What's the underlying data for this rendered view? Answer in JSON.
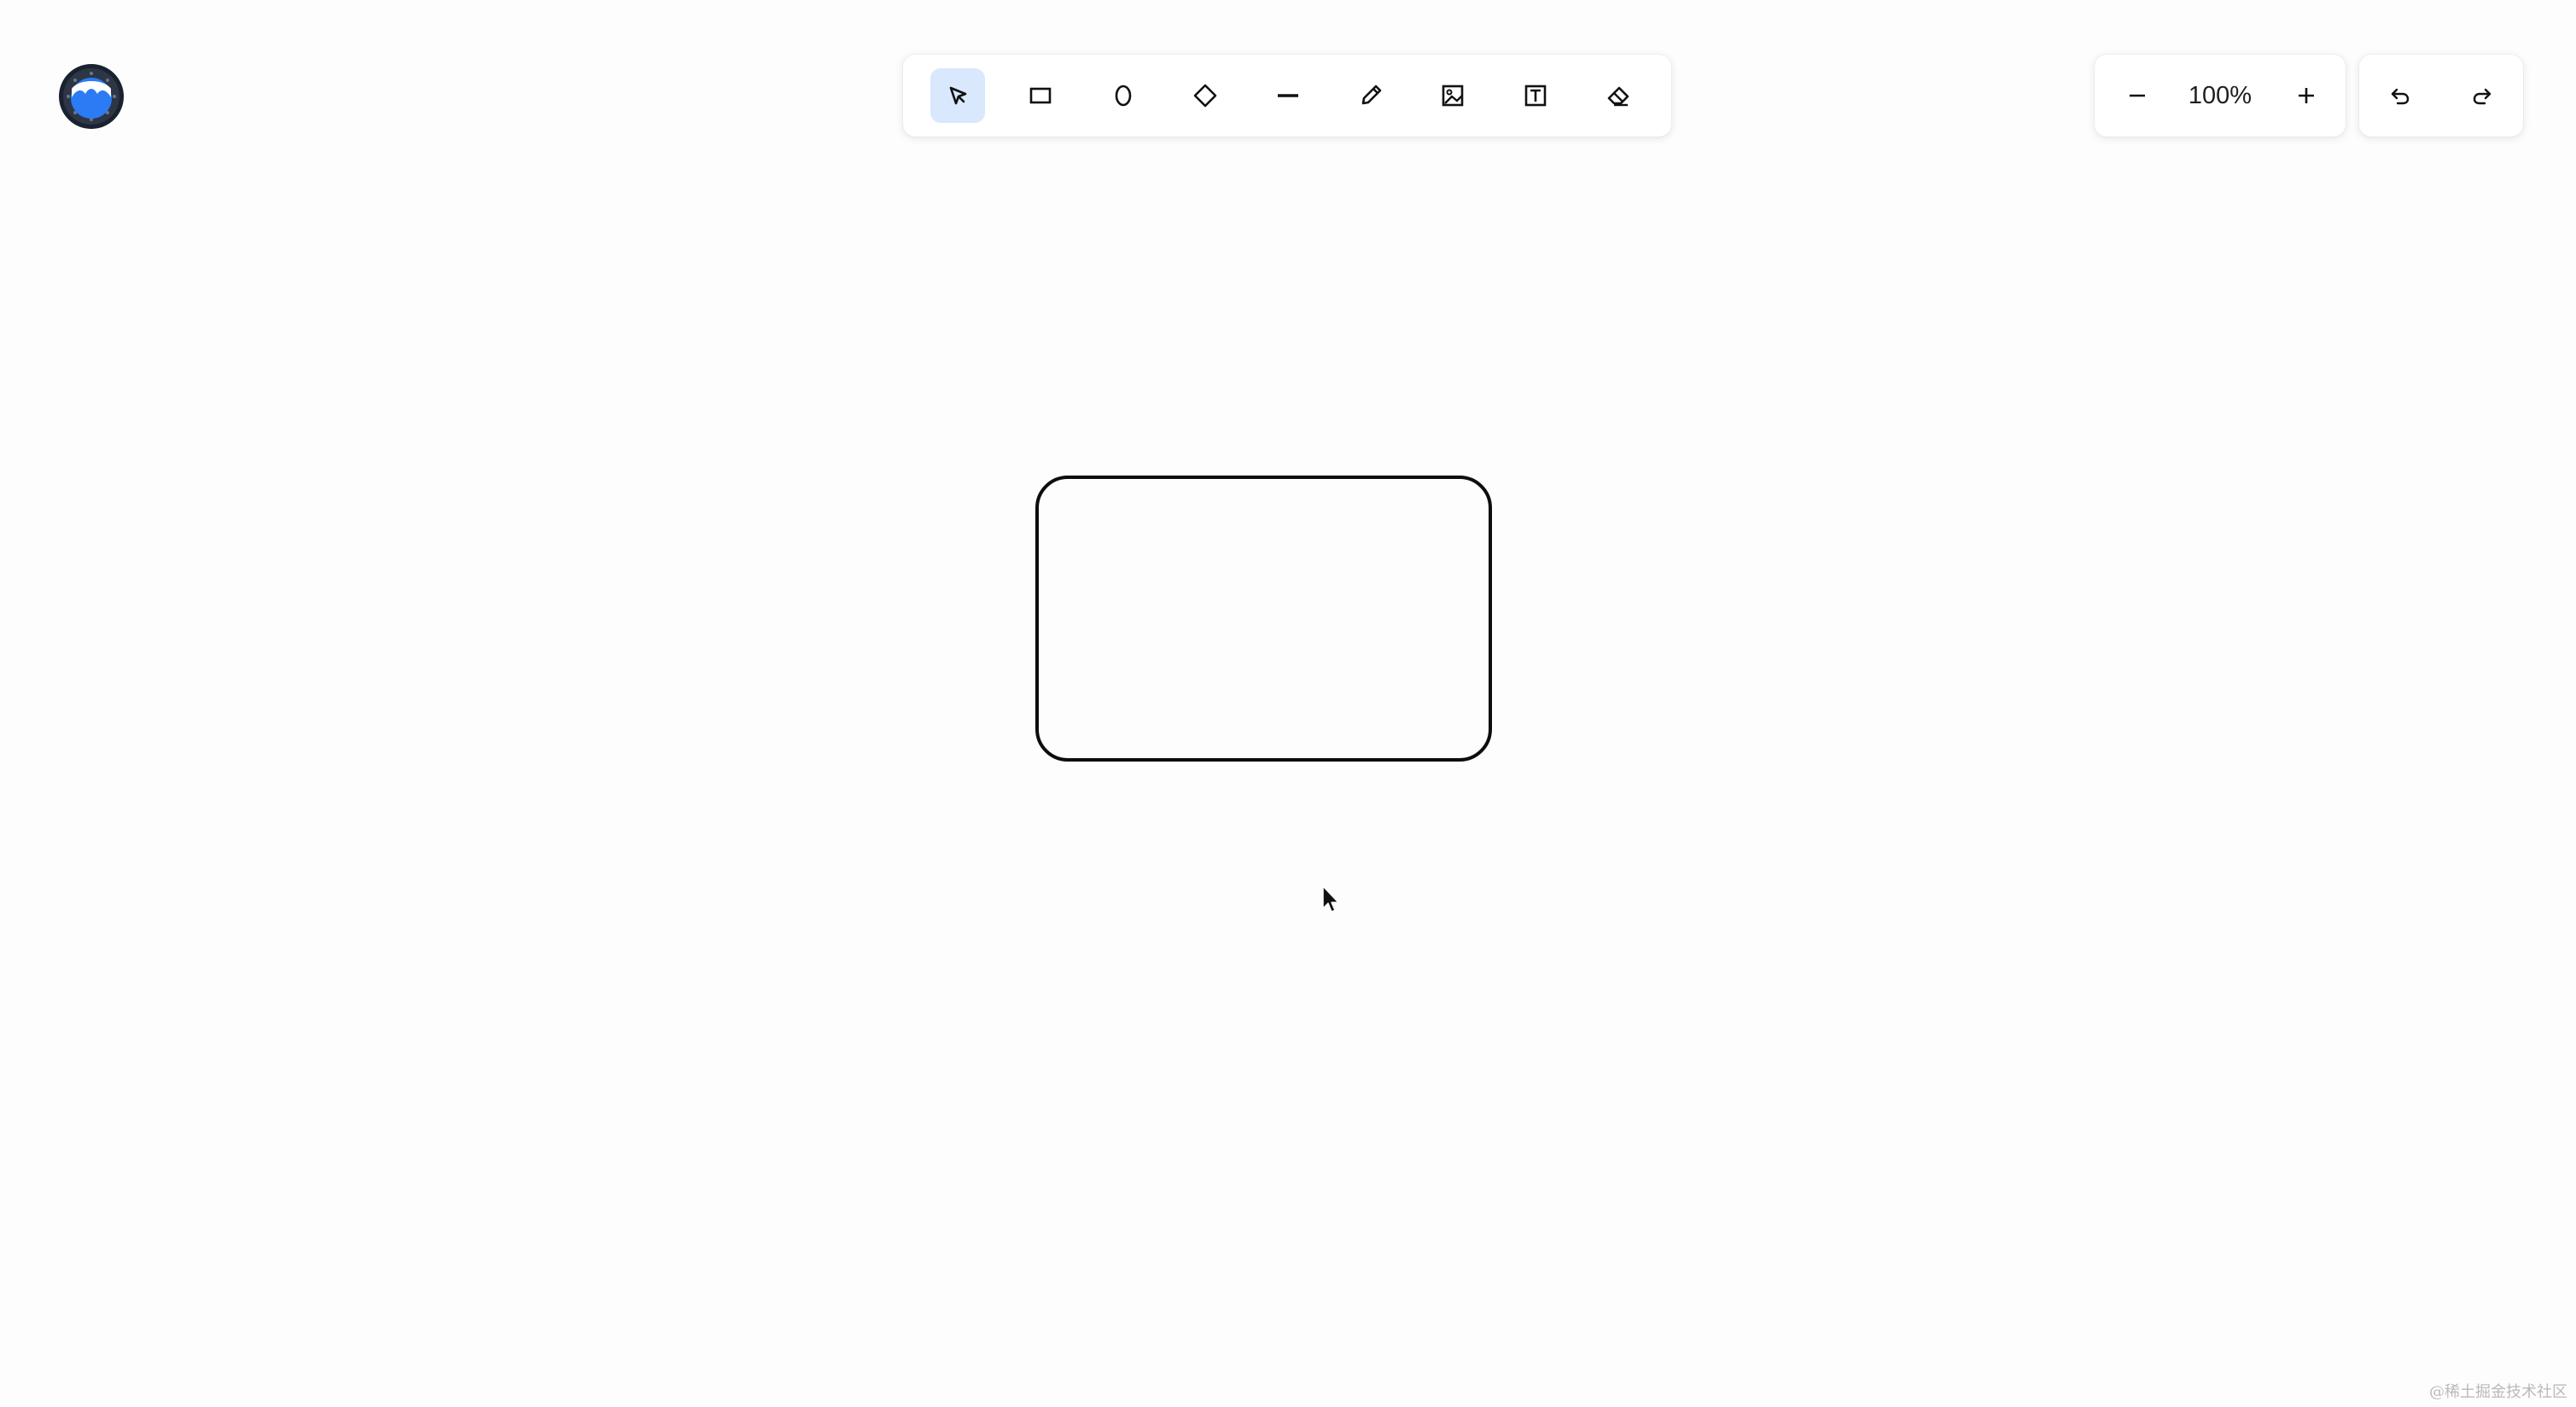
{
  "app": {
    "logo_icon": "juejin-logo-icon"
  },
  "toolbar": {
    "active_tool": "select",
    "tools": [
      {
        "id": "select",
        "icon": "pointer-arrow-icon"
      },
      {
        "id": "rectangle",
        "icon": "rectangle-icon"
      },
      {
        "id": "ellipse",
        "icon": "ellipse-icon"
      },
      {
        "id": "diamond",
        "icon": "diamond-icon"
      },
      {
        "id": "line",
        "icon": "line-icon"
      },
      {
        "id": "pencil",
        "icon": "pencil-icon"
      },
      {
        "id": "image",
        "icon": "image-icon"
      },
      {
        "id": "text",
        "icon": "text-icon"
      },
      {
        "id": "eraser",
        "icon": "eraser-icon"
      }
    ],
    "active_color": "#d9e8fd"
  },
  "zoom": {
    "value": "100%",
    "decrease_icon": "minus-icon",
    "increase_icon": "plus-icon"
  },
  "history": {
    "undo_icon": "undo-icon",
    "redo_icon": "redo-icon"
  },
  "canvas": {
    "shapes": [
      {
        "type": "rounded-rectangle",
        "stroke": "#0d0d0d"
      }
    ]
  },
  "watermark": {
    "text": "@稀土掘金技术社区"
  }
}
